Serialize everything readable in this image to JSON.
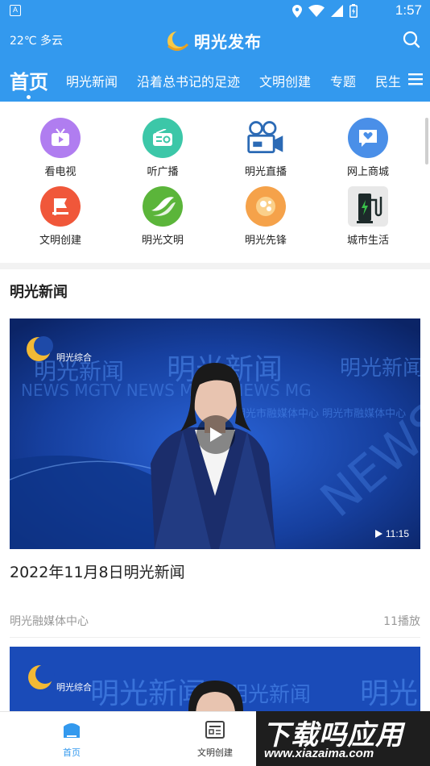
{
  "status_bar": {
    "time": "1:57",
    "notif_icon": "A"
  },
  "header": {
    "weather": "22℃ 多云",
    "app_title": "明光发布",
    "tabs": [
      {
        "label": "首页",
        "active": true
      },
      {
        "label": "明光新闻"
      },
      {
        "label": "沿着总书记的足迹"
      },
      {
        "label": "文明创建"
      },
      {
        "label": "专题"
      },
      {
        "label": "民生"
      }
    ]
  },
  "quick_grid": [
    {
      "label": "看电视",
      "icon": "tv-icon",
      "color": "#b07df0"
    },
    {
      "label": "听广播",
      "icon": "radio-icon",
      "color": "#3cc7a8"
    },
    {
      "label": "明光直播",
      "icon": "camera-icon",
      "color": "#2b6ab5"
    },
    {
      "label": "网上商城",
      "icon": "shop-icon",
      "color": "#4a8fe8"
    },
    {
      "label": "文明创建",
      "icon": "flag-icon",
      "color": "#f0573a"
    },
    {
      "label": "明光文明",
      "icon": "hands-icon",
      "color": "#5bb53a"
    },
    {
      "label": "明光先锋",
      "icon": "pioneer-icon",
      "color": "#f5a24a"
    },
    {
      "label": "城市生活",
      "icon": "charging-icon",
      "color": "#2a9a3a"
    }
  ],
  "section": {
    "title": "明光新闻"
  },
  "news": [
    {
      "title": "2022年11月8日明光新闻",
      "source": "明光融媒体中心",
      "plays": "11播放",
      "duration": "11:15",
      "channel": "明光综合"
    },
    {
      "channel": "明光综合"
    }
  ],
  "bottom_nav": [
    {
      "label": "首页",
      "icon": "home-icon",
      "active": true
    },
    {
      "label": "文明创建",
      "icon": "news-icon"
    }
  ],
  "watermark": {
    "main": "下载吗应用",
    "sub": "www.xiazaima.com"
  },
  "colors": {
    "brand_blue": "#3399ee",
    "bg_gray": "#f2f2f2"
  }
}
